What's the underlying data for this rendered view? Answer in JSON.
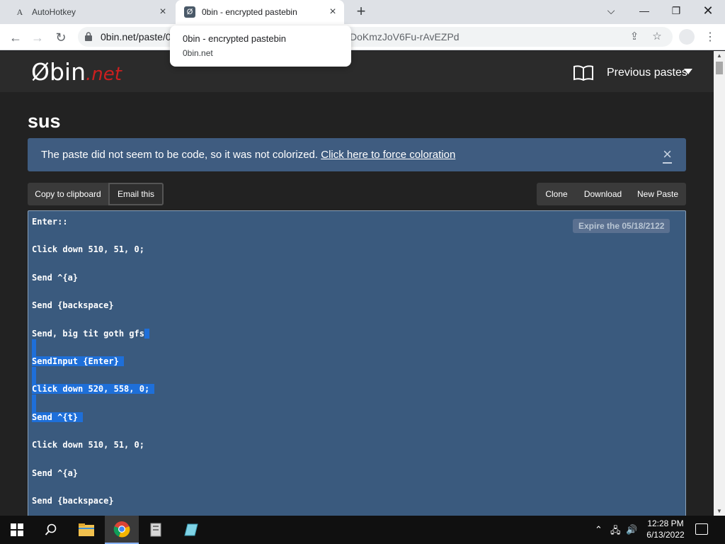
{
  "browser": {
    "tabs": [
      {
        "title": "AutoHotkey",
        "favicon": "A"
      },
      {
        "title": "0bin - encrypted pastebin",
        "favicon": "Ø"
      }
    ],
    "url_left": "0bin.net/paste/0",
    "url_right": "DoKmzJoV6Fu-rAvEZPd",
    "hover_card": {
      "title": "0bin - encrypted pastebin",
      "domain": "0bin.net"
    }
  },
  "site": {
    "logo_main": "Øbin",
    "logo_suffix": ".net",
    "previous_pastes": "Previous pastes"
  },
  "paste": {
    "title": "sus",
    "alert_text": "The paste did not seem to be code, so it was not colorized.",
    "alert_link": "Click here to force coloration",
    "alert_close": "×",
    "buttons": {
      "copy": "Copy to clipboard",
      "email": "Email this",
      "clone": "Clone",
      "download": "Download",
      "new_paste": "New Paste"
    },
    "expire": "Expire the 05/18/2122",
    "lines": [
      "Enter::",
      "Click down 510, 51, 0;",
      "Send ^{a}",
      "Send {backspace}",
      "Send, big tit goth gfs",
      "SendInput {Enter}",
      "Click down 520, 558, 0;",
      "Send ^{t}",
      "Click down 510, 51, 0;",
      "Send ^{a}",
      "Send {backspace}"
    ]
  },
  "taskbar": {
    "time": "12:28 PM",
    "date": "6/13/2022"
  },
  "colors": {
    "alert_bg": "#3f5c80",
    "code_bg": "#3a5a7e",
    "selection": "#1e6fd9",
    "logo_accent": "#cc1f1f"
  }
}
